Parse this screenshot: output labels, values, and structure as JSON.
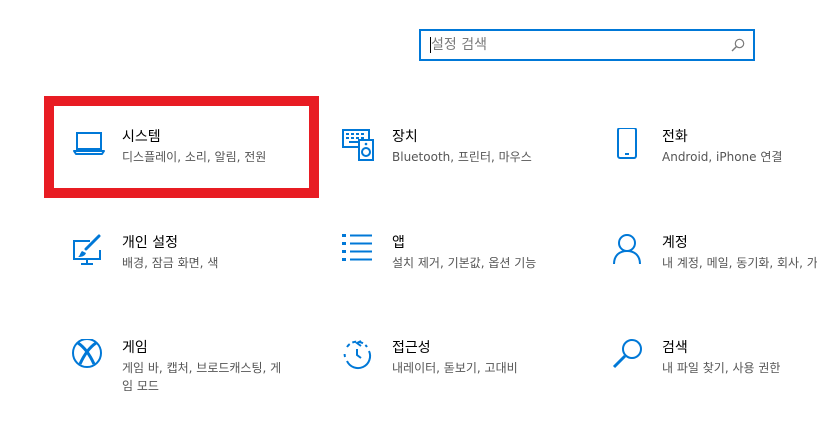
{
  "search": {
    "placeholder": "설정 검색",
    "value": ""
  },
  "colors": {
    "accent": "#0078d7",
    "highlight": "#e81c23",
    "secondary_text": "#555555"
  },
  "tiles": [
    {
      "title": "시스템",
      "desc": "디스플레이, 소리, 알림, 전원",
      "icon": "laptop-icon"
    },
    {
      "title": "장치",
      "desc": "Bluetooth, 프린터, 마우스",
      "icon": "keyboard-speaker-icon"
    },
    {
      "title": "전화",
      "desc": "Android, iPhone 연결",
      "icon": "phone-icon"
    },
    {
      "title": "개인 설정",
      "desc": "배경, 잠금 화면, 색",
      "icon": "personalization-brush-icon"
    },
    {
      "title": "앱",
      "desc": "설치 제거, 기본값, 옵션 기능",
      "icon": "apps-list-icon"
    },
    {
      "title": "계정",
      "desc": "내 계정, 메일, 동기화, 회사, 가족",
      "icon": "person-icon"
    },
    {
      "title": "게임",
      "desc": "게임 바, 캡처, 브로드캐스팅, 게임 모드",
      "icon": "xbox-icon"
    },
    {
      "title": "접근성",
      "desc": "내레이터, 돋보기, 고대비",
      "icon": "ease-of-access-icon"
    },
    {
      "title": "검색",
      "desc": "내 파일 찾기, 사용 권한",
      "icon": "search-icon"
    }
  ]
}
